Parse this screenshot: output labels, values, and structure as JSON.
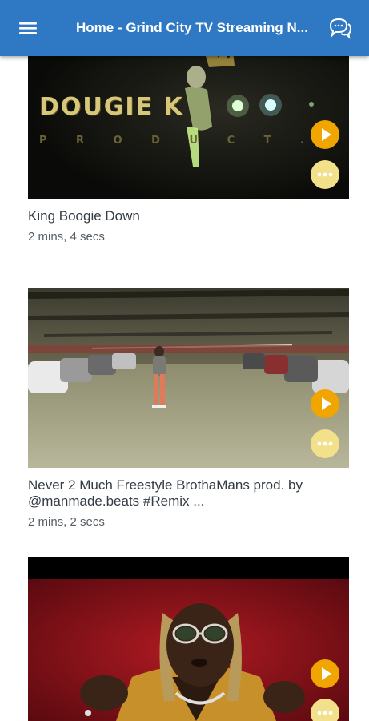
{
  "app_bar": {
    "title": "Home - Grind City TV Streaming N...",
    "menu_icon": "hamburger-menu-icon",
    "chat_icon": "chat-bubbles-icon",
    "background": "#2f78c4"
  },
  "videos": [
    {
      "title": "King Boogie Down",
      "duration": "2 mins, 4 secs",
      "thumbnail_text_main": "DOUGIE K",
      "thumbnail_text_sub": "P R O D U C T . . ."
    },
    {
      "title": "Never 2 Much Freestyle BrothaMans prod. by @manmade.beats #Remix ...",
      "duration": "2 mins, 2 secs"
    },
    {
      "title": "",
      "duration": ""
    }
  ],
  "colors": {
    "play_button": "#f0a500",
    "more_button": "#f3e08a",
    "title_text": "#333b45"
  }
}
